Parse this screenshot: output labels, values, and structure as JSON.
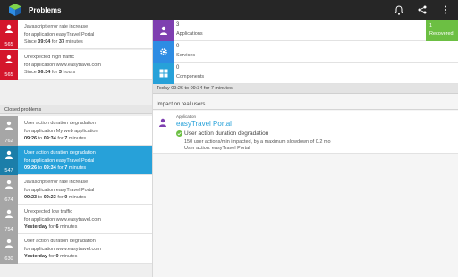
{
  "app": {
    "title": "Problems"
  },
  "colors": {
    "open": "#d4162c",
    "closed": "#a6a6a6",
    "selected": "#27a1d9",
    "applications": "#7e3fb0",
    "services": "#2e8ce3",
    "components": "#27a1d9",
    "recovered": "#6cbf43"
  },
  "open_problems": [
    {
      "id": "565",
      "line1": "Javascript error rate increase",
      "line2": "for application easyTravel Portal",
      "line3_prefix": "Since ",
      "line3_a": "09:04",
      "line3_mid": " for ",
      "line3_b": "37",
      "line3_suffix": " minutes"
    },
    {
      "id": "565",
      "line1": "Unexpected high traffic",
      "line2": "for application www.easytravel.com",
      "line3_prefix": "Since ",
      "line3_a": "06:34",
      "line3_mid": " for ",
      "line3_b": "3",
      "line3_suffix": " hours"
    }
  ],
  "closed_header": "Closed problems",
  "closed_problems": [
    {
      "id": "762",
      "line1": "User action duration degradation",
      "line2": "for application My web application",
      "line3_a": "09:26",
      "line3_mid": " to ",
      "line3_b": "09:34",
      "line3_c": " for ",
      "line3_d": "7",
      "line3_suffix": " minutes"
    },
    {
      "id": "547",
      "line1": "User action duration degradation",
      "line2": "for application easyTravel Portal",
      "line3_a": "09:26",
      "line3_mid": " to ",
      "line3_b": "09:34",
      "line3_c": " for ",
      "line3_d": "7",
      "line3_suffix": " minutes"
    },
    {
      "id": "674",
      "line1": "Javascript error rate increase",
      "line2": "for application easyTravel Portal",
      "line3_a": "09:23",
      "line3_mid": " to ",
      "line3_b": "09:23",
      "line3_c": " for ",
      "line3_d": "0",
      "line3_suffix": " minutes"
    },
    {
      "id": "754",
      "line1": "Unexpected low traffic",
      "line2": "for application www.easytravel.com",
      "line3_a": "Yesterday",
      "line3_mid": "",
      "line3_b": "",
      "line3_c": " for ",
      "line3_d": "6",
      "line3_suffix": " minutes"
    },
    {
      "id": "630",
      "line1": "User action duration degradation",
      "line2": "for application www.easytravel.com",
      "line3_a": "Yesterday",
      "line3_mid": "",
      "line3_b": "",
      "line3_c": " for ",
      "line3_d": "0",
      "line3_suffix": " minutes"
    }
  ],
  "entities": [
    {
      "count": "3",
      "label": "Applications",
      "icon": "user-icon"
    },
    {
      "count": "0",
      "label": "Services",
      "icon": "gear-icon"
    },
    {
      "count": "0",
      "label": "Components",
      "icon": "grid-icon"
    }
  ],
  "recovered": {
    "count": "1",
    "label": "Recovered"
  },
  "timebar": "Today 09:26 to 09:34 for 7 minutes",
  "impact": {
    "header": "Impact on real users",
    "kind": "Application",
    "name": "easyTravel Portal",
    "title": "User action duration degradation",
    "line1": "150 user actions/min impacted, by a maximum slowdown of 0.2 mo",
    "line2": "User action: easyTravel Portal"
  }
}
